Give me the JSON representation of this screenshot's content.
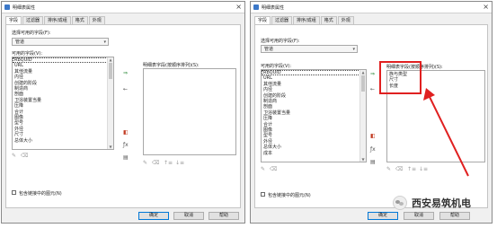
{
  "left_dialog": {
    "title": "明细表属性",
    "tabs": [
      "字段",
      "过滤器",
      "排序/成组",
      "格式",
      "外观"
    ],
    "select_from_label": "选择可用的字段(F):",
    "category_value": "管道",
    "available_label": "可用的字段(V):",
    "available_fields": [
      "RbQUID",
      "URL",
      "其他流量",
      "内径",
      "创建的阶段",
      "制造商",
      "剖面",
      "卫浴装置当量",
      "压降",
      "合计",
      "图像",
      "型号",
      "外径",
      "尺寸",
      "总体大小"
    ],
    "scheduled_label": "明细表字段(按顺序排列)(S):",
    "scheduled_fields": [],
    "include_links_label": "包含链接中的图元(N)",
    "buttons": {
      "ok": "确定",
      "cancel": "取消",
      "help": "帮助"
    }
  },
  "right_dialog": {
    "title": "明细表属性",
    "tabs": [
      "字段",
      "过滤器",
      "排序/成组",
      "格式",
      "外观"
    ],
    "select_from_label": "选择可用的字段(F):",
    "category_value": "管道",
    "available_label": "可用的字段(V):",
    "available_fields": [
      "RbQUID",
      "URL",
      "其他流量",
      "内径",
      "创建的阶段",
      "制造商",
      "剖面",
      "卫浴装置当量",
      "压降",
      "合计",
      "图像",
      "型号",
      "外径",
      "总体大小",
      "成本"
    ],
    "scheduled_label": "明细表字段(按顺序排列)(S):",
    "scheduled_fields": [
      "族与类型",
      "尺寸",
      "长度"
    ],
    "include_links_label": "包含链接中的图元(N)",
    "buttons": {
      "ok": "确定",
      "cancel": "取消",
      "help": "帮助"
    }
  },
  "icons": {
    "add_field": "add-field-icon",
    "remove_field": "remove-field-icon",
    "close": "close-icon",
    "annotation_color": "#e02020"
  },
  "watermark": {
    "text": "西安易筑机电"
  }
}
